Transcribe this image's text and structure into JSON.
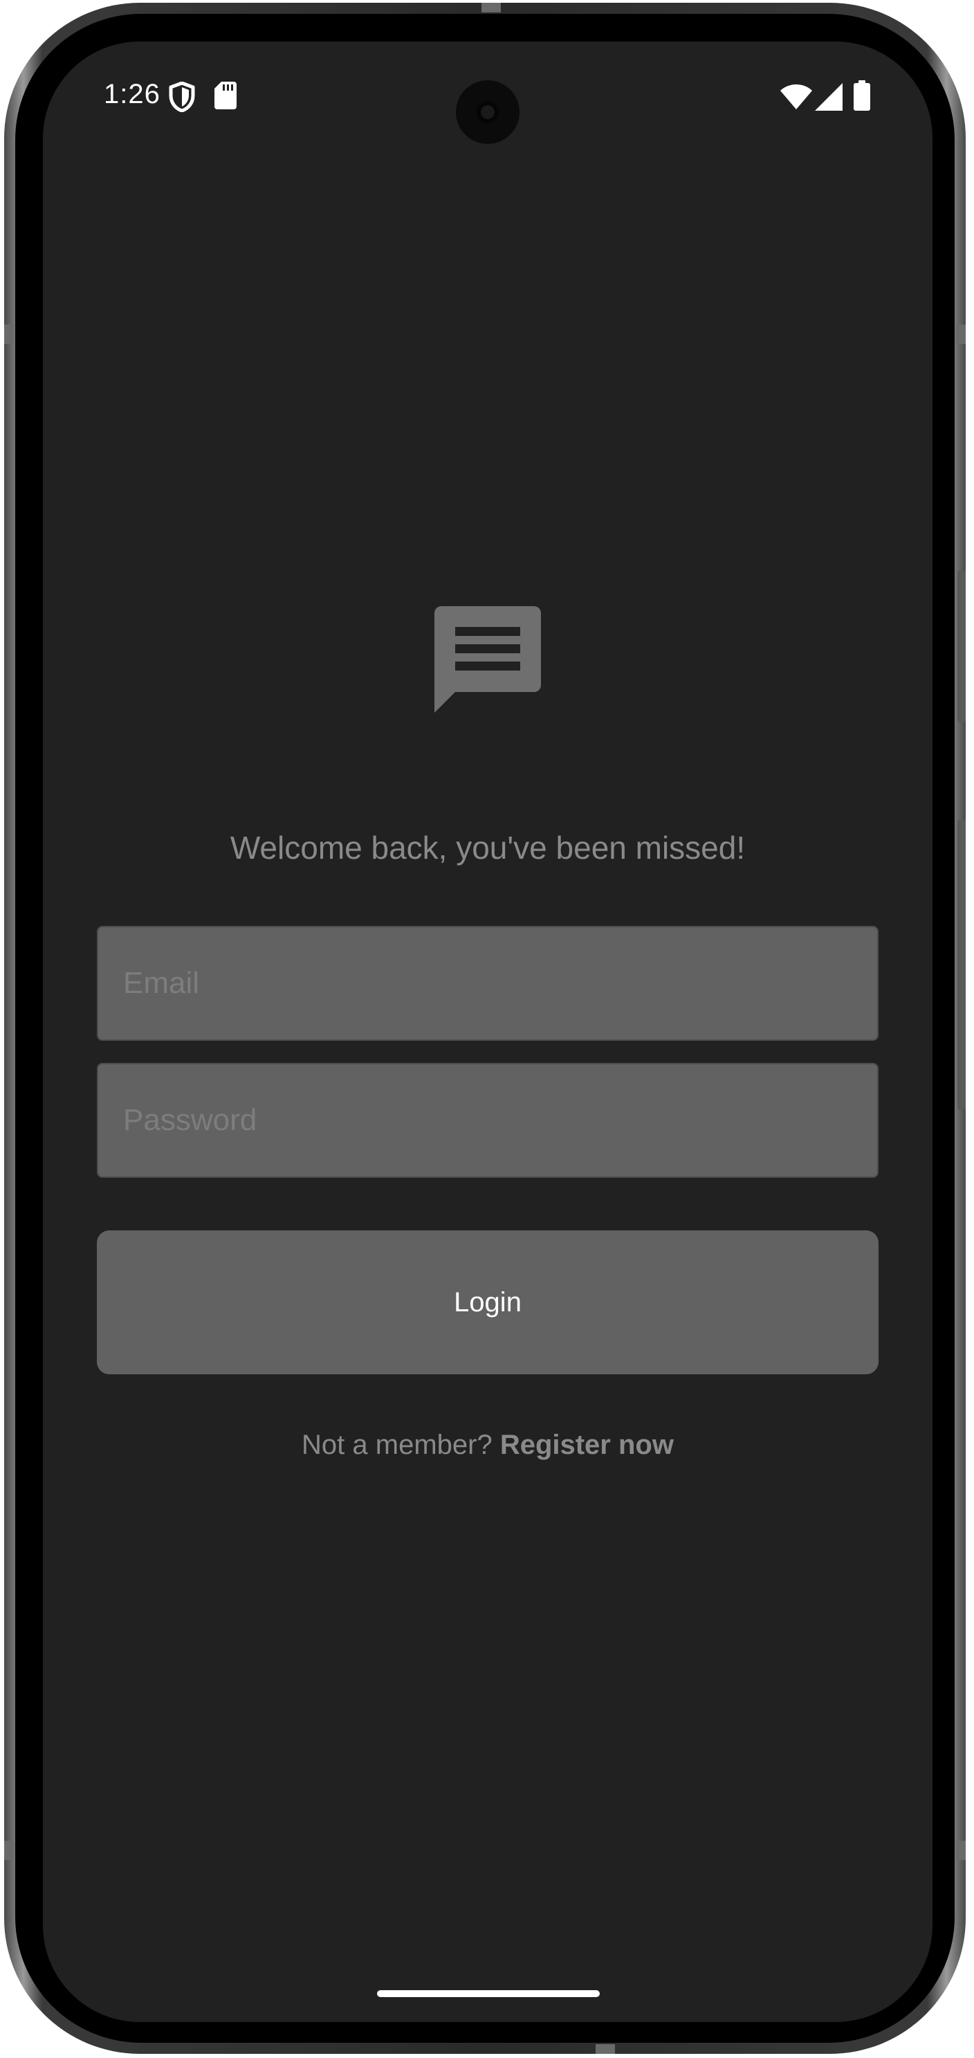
{
  "status_bar": {
    "time": "1:26",
    "icons": [
      "shield-icon",
      "sd-card-icon",
      "wifi-icon",
      "cellular-signal-icon",
      "battery-icon"
    ]
  },
  "login": {
    "logo_icon": "chat-message-icon",
    "welcome_text": "Welcome back, you've been missed!",
    "email_placeholder": "Email",
    "email_value": "",
    "password_placeholder": "Password",
    "password_value": "",
    "login_button_label": "Login",
    "register_prompt": "Not a member?",
    "register_link": "Register now"
  },
  "colors": {
    "background": "#212121",
    "field_fill": "#626262",
    "button_fill": "#626262",
    "muted_text": "#8a8a8a",
    "placeholder_text": "#7d7d7d",
    "white": "#ffffff"
  }
}
